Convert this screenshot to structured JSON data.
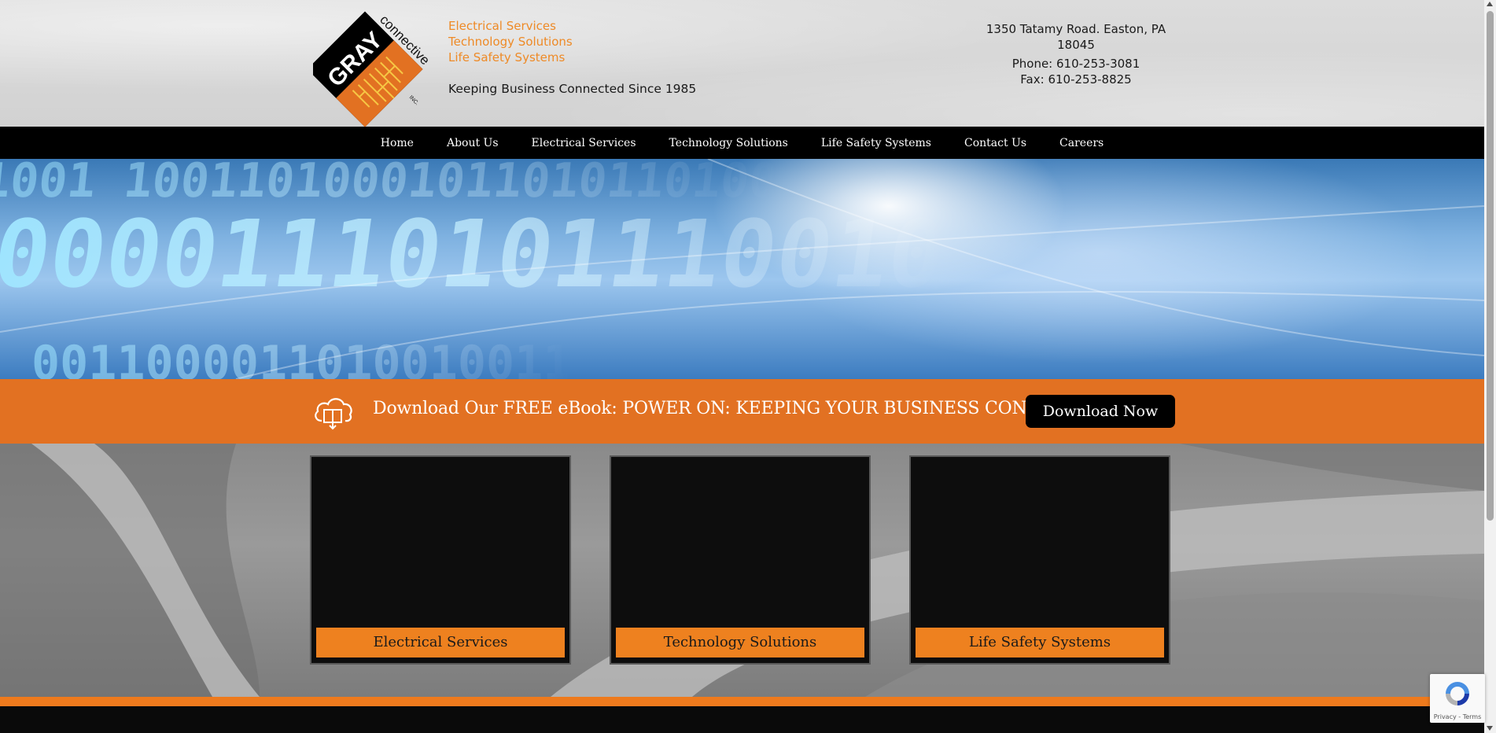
{
  "header": {
    "logo_alt": "Gray Connective Inc.",
    "logo_text": {
      "brand": "GRAY",
      "sub": "connective",
      "inc": "INC."
    },
    "taglines": [
      "Electrical Services",
      "Technology Solutions",
      "Life Safety Systems"
    ],
    "since": "Keeping Business Connected Since 1985",
    "address": "1350 Tatamy Road. Easton, PA 18045",
    "phone": "Phone: 610-253-3081",
    "fax": "Fax: 610-253-8825"
  },
  "nav": {
    "items": [
      {
        "label": "Home"
      },
      {
        "label": "About Us"
      },
      {
        "label": "Electrical Services"
      },
      {
        "label": "Technology Solutions"
      },
      {
        "label": "Life Safety Systems"
      },
      {
        "label": "Contact Us"
      },
      {
        "label": "Careers"
      }
    ]
  },
  "promo": {
    "text": "Download Our FREE eBook: POWER ON: KEEPING YOUR BUSINESS CONNECTED",
    "button_label": "Download Now",
    "icon": "cloud-ebook-icon"
  },
  "cards": [
    {
      "label": "Electrical Services"
    },
    {
      "label": "Technology Solutions"
    },
    {
      "label": "Life Safety Systems"
    }
  ],
  "recaptcha": {
    "links": "Privacy - Terms"
  },
  "colors": {
    "accent_orange": "#ee811f",
    "promo_orange": "#e27122",
    "nav_black": "#000000",
    "tagline_orange": "#ee8a26"
  }
}
